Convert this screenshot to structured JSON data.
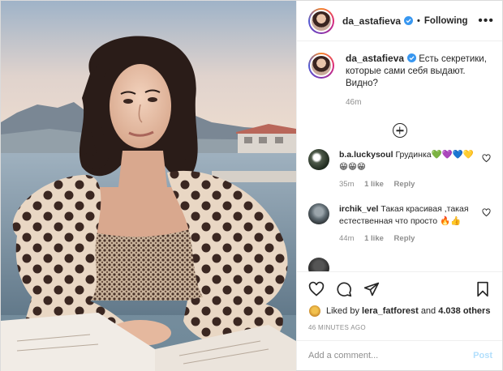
{
  "header": {
    "username": "da_astafieva",
    "separator": "•",
    "follow_status": "Following",
    "more": "•••"
  },
  "caption": {
    "username": "da_astafieva",
    "text": "Есть секретики, которые сами себя выдают. Видно?",
    "time": "46m"
  },
  "comments": [
    {
      "username": "b.a.luckysoul",
      "text": "Грудинка💚💜💙💛😁😁😁",
      "time": "35m",
      "likes": "1 like",
      "reply": "Reply"
    },
    {
      "username": "irchik_vel",
      "text": "Такая красивая ,такая естественная что просто 🔥👍",
      "time": "44m",
      "likes": "1 like",
      "reply": "Reply"
    }
  ],
  "likes": {
    "prefix": "Liked by",
    "user": "lera_fatforest",
    "and": "and",
    "others": "4.038 others"
  },
  "post_time": "46 MINUTES AGO",
  "add_comment": {
    "placeholder": "Add a comment...",
    "post_label": "Post"
  },
  "colors": {
    "verified": "#3897f0",
    "post_disabled": "#b2dffc",
    "dress_base": "#e6d3c0",
    "dress_dots": "#3a2620"
  }
}
